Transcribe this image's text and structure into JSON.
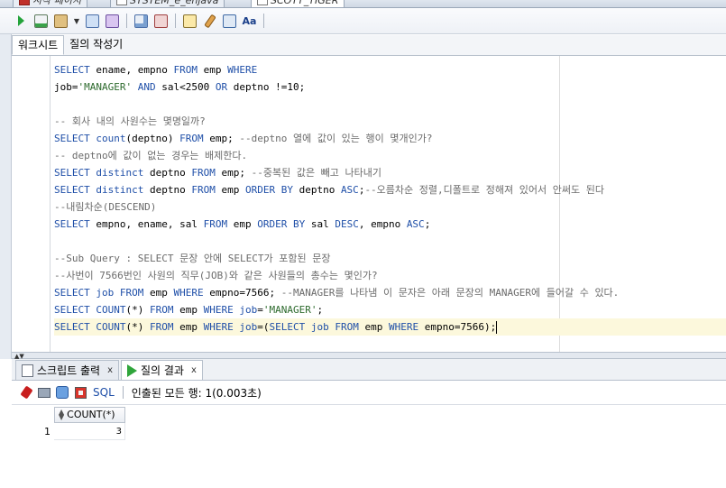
{
  "window_tabs": [
    {
      "label": "시작 페이지",
      "active": false
    },
    {
      "label": "SYSTEM_e_enjava",
      "active": false
    },
    {
      "label": "SCOTT_TIGER",
      "active": true
    }
  ],
  "editor_tabs": [
    {
      "label": "워크시트",
      "active": true
    },
    {
      "label": "질의 작성기",
      "active": false
    }
  ],
  "editor_lines": [
    {
      "segments": [
        [
          "kw",
          "SELECT"
        ],
        [
          "t",
          " ename, empno "
        ],
        [
          "kw",
          "FROM"
        ],
        [
          "t",
          " emp "
        ],
        [
          "kw",
          "WHERE"
        ]
      ]
    },
    {
      "segments": [
        [
          "t",
          "job="
        ],
        [
          "str",
          "'MANAGER'"
        ],
        [
          "t",
          " "
        ],
        [
          "kw",
          "AND"
        ],
        [
          "t",
          " sal<2500 "
        ],
        [
          "kw",
          "OR"
        ],
        [
          "t",
          " deptno !=10;"
        ]
      ]
    },
    {
      "segments": []
    },
    {
      "segments": [
        [
          "cmt",
          "-- 회사 내의 사원수는 몇명일까?"
        ]
      ]
    },
    {
      "segments": [
        [
          "kw",
          "SELECT"
        ],
        [
          "t",
          " "
        ],
        [
          "kw",
          "count"
        ],
        [
          "t",
          "(deptno) "
        ],
        [
          "kw",
          "FROM"
        ],
        [
          "t",
          " emp; "
        ],
        [
          "cmt",
          "--deptno 열에 값이 있는 행이 몇개인가?"
        ]
      ]
    },
    {
      "segments": [
        [
          "cmt",
          "-- deptno에 값이 없는 경우는 배제한다."
        ]
      ]
    },
    {
      "segments": [
        [
          "kw",
          "SELECT"
        ],
        [
          "t",
          " "
        ],
        [
          "kw",
          "distinct"
        ],
        [
          "t",
          " deptno "
        ],
        [
          "kw",
          "FROM"
        ],
        [
          "t",
          " emp; "
        ],
        [
          "cmt",
          "--중복된 값은 빼고 나타내기"
        ]
      ]
    },
    {
      "segments": [
        [
          "kw",
          "SELECT"
        ],
        [
          "t",
          " "
        ],
        [
          "kw",
          "distinct"
        ],
        [
          "t",
          " deptno "
        ],
        [
          "kw",
          "FROM"
        ],
        [
          "t",
          " emp "
        ],
        [
          "kw",
          "ORDER BY"
        ],
        [
          "t",
          " deptno "
        ],
        [
          "kw",
          "ASC"
        ],
        [
          "t",
          ";"
        ],
        [
          "cmt",
          "--오름차순 정렬,디폴트로 정해져 있어서 안써도 된다"
        ]
      ]
    },
    {
      "segments": [
        [
          "cmt",
          "--내림차순(DESCEND)"
        ]
      ]
    },
    {
      "segments": [
        [
          "kw",
          "SELECT"
        ],
        [
          "t",
          " empno, ename, sal "
        ],
        [
          "kw",
          "FROM"
        ],
        [
          "t",
          " emp "
        ],
        [
          "kw",
          "ORDER BY"
        ],
        [
          "t",
          " sal "
        ],
        [
          "kw",
          "DESC"
        ],
        [
          "t",
          ", empno "
        ],
        [
          "kw",
          "ASC"
        ],
        [
          "t",
          ";"
        ]
      ]
    },
    {
      "segments": []
    },
    {
      "segments": [
        [
          "cmt",
          "--Sub Query : SELECT 문장 안에 SELECT가 포함된 문장"
        ]
      ]
    },
    {
      "segments": [
        [
          "cmt",
          "--사번이 7566번인 사원의 직무(JOB)와 같은 사원들의 총수는 몇인가?"
        ]
      ]
    },
    {
      "segments": [
        [
          "kw",
          "SELECT"
        ],
        [
          "t",
          " "
        ],
        [
          "kw",
          "job"
        ],
        [
          "t",
          " "
        ],
        [
          "kw",
          "FROM"
        ],
        [
          "t",
          " emp "
        ],
        [
          "kw",
          "WHERE"
        ],
        [
          "t",
          " empno=7566; "
        ],
        [
          "cmt",
          "--MANAGER를 나타냄 이 문자은 아래 문장의 MANAGER에 들어갈 수 있다."
        ]
      ]
    },
    {
      "segments": [
        [
          "kw",
          "SELECT"
        ],
        [
          "t",
          " "
        ],
        [
          "kw",
          "COUNT"
        ],
        [
          "t",
          "(*) "
        ],
        [
          "kw",
          "FROM"
        ],
        [
          "t",
          " emp "
        ],
        [
          "kw",
          "WHERE"
        ],
        [
          "t",
          " "
        ],
        [
          "kw",
          "job"
        ],
        [
          "t",
          "="
        ],
        [
          "str",
          "'MANAGER'"
        ],
        [
          "t",
          ";"
        ]
      ]
    },
    {
      "segments": [
        [
          "kw",
          "SELECT"
        ],
        [
          "t",
          " "
        ],
        [
          "kw",
          "COUNT"
        ],
        [
          "t",
          "(*) "
        ],
        [
          "kw",
          "FROM"
        ],
        [
          "t",
          " emp "
        ],
        [
          "kw",
          "WHERE"
        ],
        [
          "t",
          " "
        ],
        [
          "kw",
          "job"
        ],
        [
          "t",
          "=("
        ],
        [
          "kw",
          "SELECT"
        ],
        [
          "t",
          " "
        ],
        [
          "kw",
          "job"
        ],
        [
          "t",
          " "
        ],
        [
          "kw",
          "FROM"
        ],
        [
          "t",
          " emp "
        ],
        [
          "kw",
          "WHERE"
        ],
        [
          "t",
          " empno=7566);"
        ]
      ],
      "current": true
    }
  ],
  "bottom_tabs": [
    {
      "label": "스크립트 출력",
      "close": "x",
      "icon": "script-output-icon",
      "active": false
    },
    {
      "label": "질의 결과",
      "close": "x",
      "icon": "run-icon",
      "active": true
    }
  ],
  "result_toolbar": {
    "sql_label": "SQL",
    "status": "인출된 모든 행: 1(0.003초)"
  },
  "result_grid": {
    "columns": [
      "COUNT(*)"
    ],
    "rows": [
      {
        "num": "1",
        "values": [
          "3"
        ]
      }
    ]
  },
  "colors": {
    "keyword": "#1f4fa8",
    "string": "#2d6a2d",
    "comment": "#6b6b6b",
    "current_line": "#fcf8dc"
  }
}
